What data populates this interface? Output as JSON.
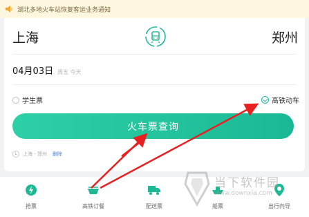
{
  "notice": {
    "text": "湖北多地火车站恢复客运业务通知",
    "icon": "speaker-icon"
  },
  "route": {
    "from": "上海",
    "to": "郑州",
    "swap_icon": "train-swap-icon"
  },
  "date": {
    "main": "04月03日",
    "sub": "周五 今天"
  },
  "options": {
    "student_label": "学生票",
    "hsr_label": "高铁动车",
    "student_checked": false,
    "hsr_checked": true
  },
  "search": {
    "label": "火车票查询"
  },
  "history": {
    "route": "上海 - 郑州",
    "delete_label": "删除"
  },
  "tabs": [
    {
      "label": "抢票",
      "icon": "lightning-icon"
    },
    {
      "label": "高铁订餐",
      "icon": "meal-icon"
    },
    {
      "label": "配送票",
      "icon": "truck-icon"
    },
    {
      "label": "船票",
      "icon": "ship-icon"
    },
    {
      "label": "出行向导",
      "icon": "location-icon"
    }
  ],
  "watermark": {
    "text": "当下软件园",
    "url": "www.downxia.com"
  },
  "colors": {
    "accent": "#1fb895",
    "annotation": "#e82020",
    "notice_bg": "#fff6df"
  }
}
